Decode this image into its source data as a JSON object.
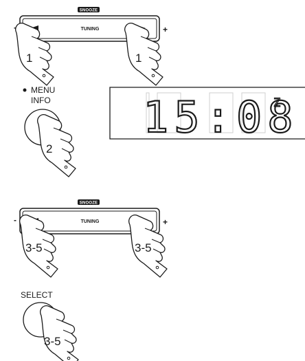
{
  "panel_top": {
    "snooze_label": "SNOOZE",
    "tuning_label": "TUNING",
    "minus": "-",
    "plus": "+",
    "step_left": "1",
    "step_right": "1"
  },
  "menu": {
    "menu_label": "MENU",
    "info_label": "INFO",
    "step": "2"
  },
  "display": {
    "time": "15:08",
    "indicator": "Z"
  },
  "panel_bottom": {
    "snooze_label": "SNOOZE",
    "tuning_label": "TUNING",
    "minus": "-",
    "plus": "+",
    "step_left": "3-5",
    "step_right": "3-5"
  },
  "select": {
    "label": "SELECT",
    "step": "3-5"
  },
  "colors": {
    "ink": "#1a1a1a",
    "background": "#ffffff"
  }
}
